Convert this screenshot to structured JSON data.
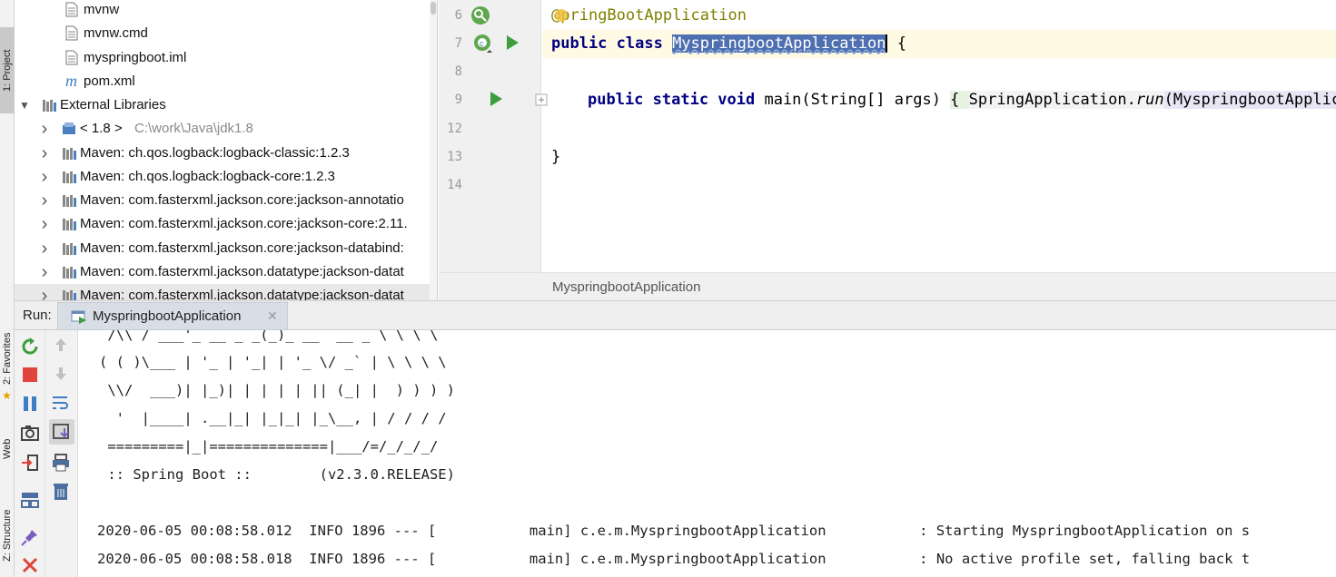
{
  "toolwindows": {
    "project": "1: Project",
    "favorites": "2: Favorites",
    "web": "Web",
    "structure": "Z: Structure"
  },
  "tree": {
    "items": [
      {
        "label": "mvnw",
        "icon": "file-icon"
      },
      {
        "label": "mvnw.cmd",
        "icon": "file-icon"
      },
      {
        "label": "myspringboot.iml",
        "icon": "iml-file-icon"
      },
      {
        "label": "pom.xml",
        "icon": "maven-icon"
      },
      {
        "label": "External Libraries",
        "icon": "library-icon"
      },
      {
        "label": "< 1.8 >",
        "extra": "C:\\work\\Java\\jdk1.8",
        "icon": "jdk-icon"
      },
      {
        "label": "Maven: ch.qos.logback:logback-classic:1.2.3",
        "icon": "library-icon"
      },
      {
        "label": "Maven: ch.qos.logback:logback-core:1.2.3",
        "icon": "library-icon"
      },
      {
        "label": "Maven: com.fasterxml.jackson.core:jackson-annotatio",
        "icon": "library-icon"
      },
      {
        "label": "Maven: com.fasterxml.jackson.core:jackson-core:2.11.",
        "icon": "library-icon"
      },
      {
        "label": "Maven: com.fasterxml.jackson.core:jackson-databind:",
        "icon": "library-icon"
      },
      {
        "label": "Maven: com.fasterxml.jackson.datatype:jackson-datat",
        "icon": "library-icon"
      },
      {
        "label": "Maven: com.fasterxml.jackson.datatype:jackson-datat",
        "icon": "library-icon"
      }
    ]
  },
  "editor": {
    "line_numbers": [
      "6",
      "7",
      "8",
      "9",
      "12",
      "13",
      "14"
    ],
    "annotation_at": "@",
    "annotation_rest": "pringBootApplication",
    "line7_kw": "public class ",
    "line7_class": "MyspringbootApplication",
    "line7_brace": " {",
    "line9_kw": "public static void ",
    "line9_sig": "main(String[] args) ",
    "line9_brace": "{ ",
    "line9_call": "SpringApplication.",
    "line9_run": "run",
    "line9_arg": "(MyspringbootApplic",
    "line13": "}",
    "breadcrumb": "MyspringbootApplication"
  },
  "run": {
    "label": "Run:",
    "tab": "MyspringbootApplication"
  },
  "console": {
    "lines": [
      " /\\\\ / ___'_ __ _ _(_)_ __  __ _ \\ \\ \\ \\",
      "( ( )\\___ | '_ | '_| | '_ \\/ _` | \\ \\ \\ \\",
      " \\\\/  ___)| |_)| | | | | || (_| |  ) ) ) )",
      "  '  |____| .__|_| |_|_| |_\\__, | / / / /",
      " =========|_|==============|___/=/_/_/_/",
      " :: Spring Boot ::        (v2.3.0.RELEASE)",
      "",
      "2020-06-05 00:08:58.012  INFO 1896 --- [           main] c.e.m.MyspringbootApplication           : Starting MyspringbootApplication on s",
      "2020-06-05 00:08:58.018  INFO 1896 --- [           main] c.e.m.MyspringbootApplication           : No active profile set, falling back t"
    ]
  },
  "colors": {
    "keyword": "#000080",
    "annotation": "#808000",
    "selection": "#4e6fb0",
    "line_highlight": "#fffae3",
    "run_green": "#3d9e3d",
    "stop_red": "#e0443c"
  }
}
